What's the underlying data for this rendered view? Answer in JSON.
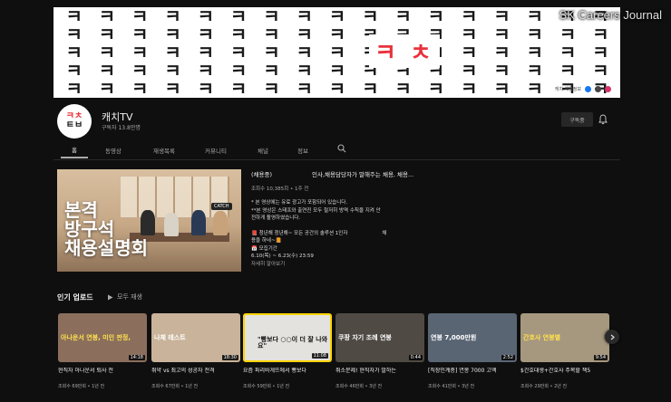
{
  "banner": {
    "pattern_char": "ㅋ",
    "logo_text": "ㅋ ㅊ",
    "links_text": "캐치 채용정보",
    "watermark": "SK Careers Journal",
    "pattern_color": "#1a1a1a",
    "logo_color": "#e8323c"
  },
  "channel": {
    "avatar_top": "ㅋㅊ",
    "avatar_bottom": "ㅌㅂ",
    "name": "캐치TV",
    "subscribers": "구독자 13.8만명",
    "subscribe_label": "구독중",
    "bell_icon": "bell-icon"
  },
  "tabs": [
    {
      "label": "홈",
      "active": true
    },
    {
      "label": "동영상",
      "active": false
    },
    {
      "label": "재생목록",
      "active": false
    },
    {
      "label": "커뮤니티",
      "active": false
    },
    {
      "label": "채널",
      "active": false
    },
    {
      "label": "정보",
      "active": false
    }
  ],
  "featured": {
    "tag": "CATCH",
    "overlay_l1": "본격",
    "overlay_l2": "방구석",
    "overlay_l3": "채용설명회",
    "title_a": "(채용중)",
    "title_b": "인사,채용담당자가 말해주는 채용, 채용...",
    "meta": "조회수 10,385회 • 1주 전",
    "desc_1": "* 본 영상에는 유료 광고가 포함되어 있습니다.",
    "desc_2": "**본 영상은 스태프와 출연진 모두 철저히 방역 수칙을 지켜 안",
    "desc_3": "전하게 촬영하였습니다.",
    "desc_4": "📕 청년해 청년해~ 모든 공간의 솔루션 1인자",
    "desc_4b": "채",
    "desc_5": "용을 하네~📙",
    "desc_6": "📅 모집기간",
    "desc_7": "6.10(목) ~ 6.23(수) 23:59",
    "more": "자세히 알아보기"
  },
  "popular": {
    "title": "인기 업로드",
    "play_all": "모두 재생",
    "videos": [
      {
        "title": "현직자 아나운서 퇴사 전",
        "meta": "조회수 69만회 • 1년 전",
        "duration": "14:18",
        "caption": "아나운서 연봉, 미인 판정,",
        "bg": "#8b6f5c"
      },
      {
        "title": "취약 vs 최고의 성공자 전격",
        "meta": "조회수 67만회 • 1년 전",
        "duration": "18:30",
        "caption": "나체 테스트",
        "bg": "#c9b39a"
      },
      {
        "title": "요즘 파리바게뜨에서 빵보다",
        "meta": "조회수 59만회 • 1년 전",
        "duration": "11:08",
        "caption": "\"빵보다 ○○이 더 잘 나와요\"",
        "bg": "#e4e2de"
      },
      {
        "title": "취소문제! 현직자가 말하는",
        "meta": "조회수 46만회 • 3년 전",
        "duration": "0:44",
        "caption": "쿠팡 자기 조례 연봉",
        "bg": "#4f4a44"
      },
      {
        "title": "[직장인계층] 연봉 7000 고액",
        "meta": "조회수 41만회 • 3년 전",
        "duration": "2:52",
        "caption": "연봉 7,000만원",
        "bg": "#5a6574"
      },
      {
        "title": "$간호대생+간호사 주목할 책5",
        "meta": "조회수 29만회 • 2년 전",
        "duration": "9:54",
        "caption": "간호사 연봉별",
        "bg": "#a6977f"
      }
    ]
  }
}
